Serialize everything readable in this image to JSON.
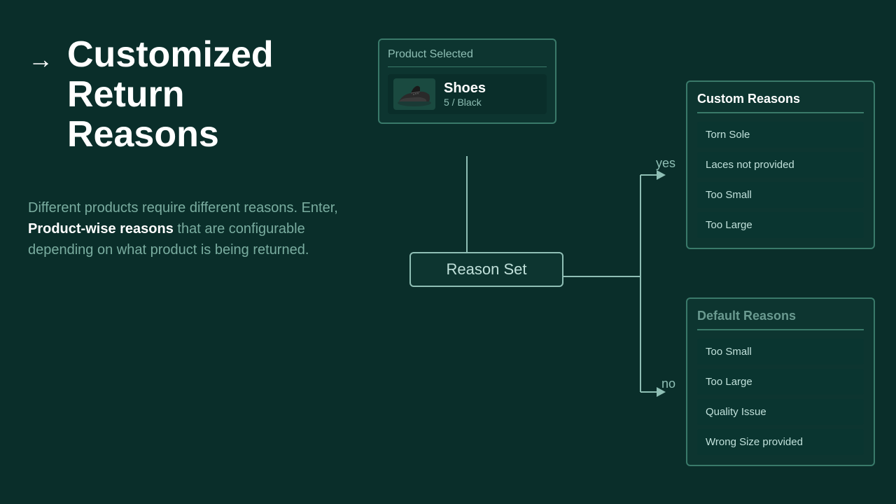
{
  "left": {
    "arrow": "→",
    "title_line1": "Customized",
    "title_line2": "Return",
    "title_line3": "Reasons",
    "description_part1": "Different products require different reasons. Enter,",
    "description_bold": "Product-wise reasons",
    "description_part2": " that are configurable depending on what product is being returned."
  },
  "product_box": {
    "label": "Product Selected",
    "product_name": "Shoes",
    "product_variant": "5 / Black"
  },
  "reason_set": {
    "label": "Reason Set"
  },
  "custom_reasons": {
    "title": "Custom Reasons",
    "items": [
      "Torn Sole",
      "Laces not provided",
      "Too Small",
      "Too Large"
    ]
  },
  "default_reasons": {
    "title": "Default Reasons",
    "items": [
      "Too Small",
      "Too Large",
      "Quality Issue",
      "Wrong Size provided"
    ]
  },
  "connector": {
    "yes_label": "yes",
    "no_label": "no"
  }
}
